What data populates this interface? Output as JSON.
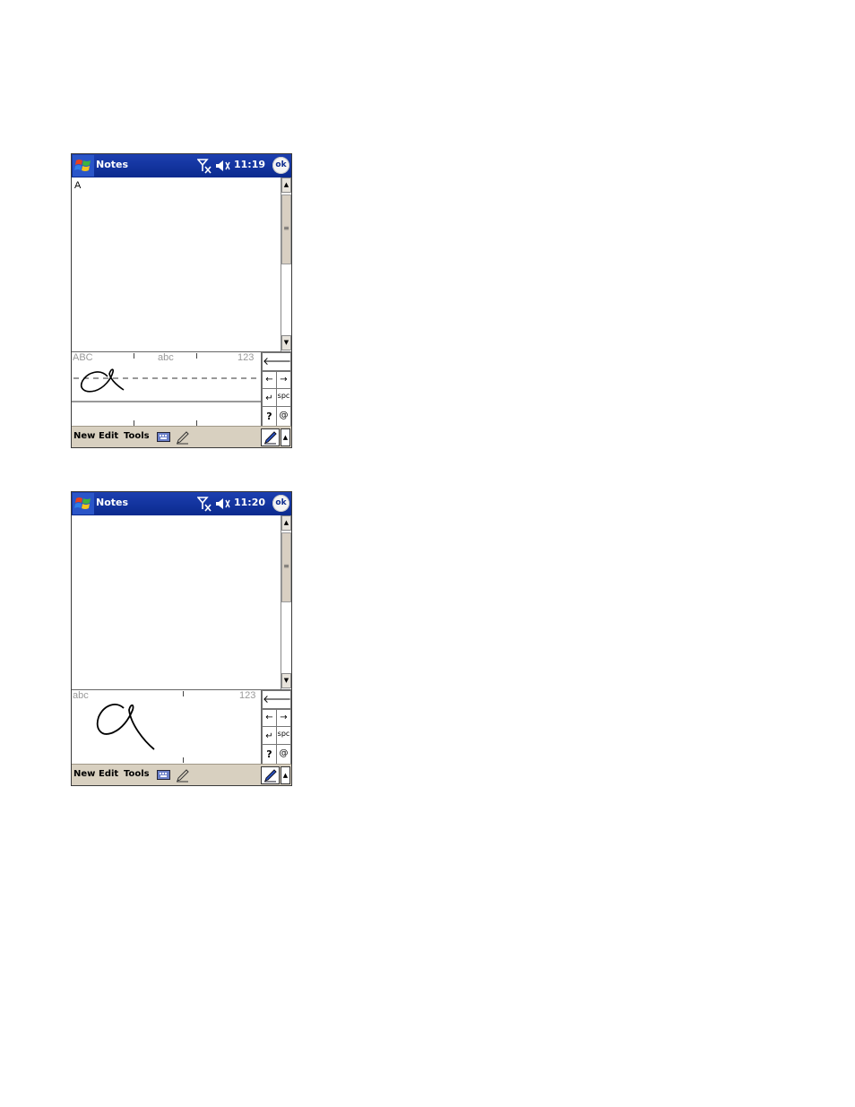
{
  "screens": [
    {
      "title": "Notes",
      "time": "11:19",
      "ok_label": "ok",
      "document_text": "A",
      "panel_labels": {
        "left": "ABC",
        "center": "abc",
        "right": "123"
      },
      "menu": {
        "new": "New",
        "edit": "Edit",
        "tools": "Tools"
      },
      "keys": {
        "space": "spc",
        "help": "?"
      }
    },
    {
      "title": "Notes",
      "time": "11:20",
      "ok_label": "ok",
      "document_text": "",
      "panel_labels": {
        "left": "abc",
        "right": "123"
      },
      "menu": {
        "new": "New",
        "edit": "Edit",
        "tools": "Tools"
      },
      "keys": {
        "space": "spc",
        "help": "?"
      }
    }
  ],
  "icons": [
    "windows-start-icon",
    "signal-icon",
    "speaker-icon",
    "backspace-icon",
    "arrow-left-icon",
    "arrow-right-icon",
    "enter-icon",
    "symbols-icon",
    "keyboard-icon",
    "pen-icon",
    "input-panel-pen-icon"
  ],
  "colors": {
    "titlebar": "#0b2a8e",
    "menubar": "#d8d0c0",
    "ink": "#000000"
  }
}
